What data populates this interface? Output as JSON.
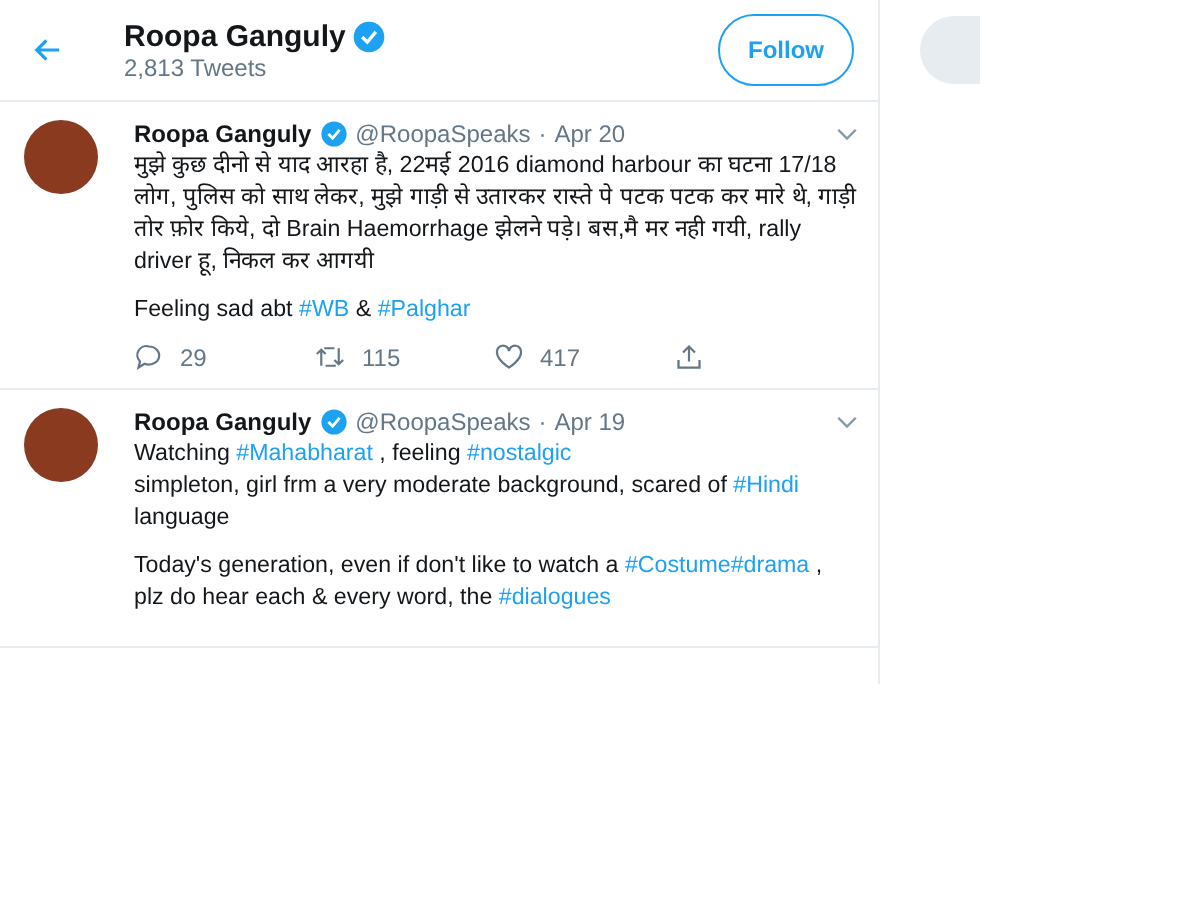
{
  "header": {
    "name": "Roopa Ganguly",
    "verified": true,
    "tweet_count": "2,813 Tweets",
    "follow_button": "Follow"
  },
  "tweets": [
    {
      "name": "Roopa Ganguly",
      "verified": true,
      "handle": "@RoopaSpeaks",
      "separator": "·",
      "date": "Apr 20",
      "paragraphs": [
        [
          {
            "kind": "text",
            "text": "मुझे कुछ दीनो से याद आरहा है, 22मई 2016 diamond harbour का घटना 17/18 लोग, पुलिस को साथ लेकर, मुझे गाड़ी से उतारकर रास्ते पे पटक पटक कर मारे थे, गाड़ी तोर फ़ोर किये, दो Brain Haemorrhage झेलने पड़े। बस,मै मर नही गयी, rally driver हू, निकल कर आगयी"
          }
        ],
        [
          {
            "kind": "text",
            "text": "Feeling sad abt "
          },
          {
            "kind": "hashtag",
            "text": "#WB"
          },
          {
            "kind": "text",
            "text": " & "
          },
          {
            "kind": "hashtag",
            "text": "#Palghar"
          }
        ]
      ],
      "actions": {
        "replies": "29",
        "retweets": "115",
        "likes": "417"
      }
    },
    {
      "name": "Roopa Ganguly",
      "verified": true,
      "handle": "@RoopaSpeaks",
      "separator": "·",
      "date": "Apr 19",
      "paragraphs": [
        [
          {
            "kind": "text",
            "text": "Watching "
          },
          {
            "kind": "hashtag",
            "text": "#Mahabharat"
          },
          {
            "kind": "text",
            "text": " , feeling "
          },
          {
            "kind": "hashtag",
            "text": "#nostalgic"
          },
          {
            "kind": "break"
          },
          {
            "kind": "text",
            "text": "simpleton, girl frm a very moderate background, scared of "
          },
          {
            "kind": "hashtag",
            "text": "#Hindi"
          },
          {
            "kind": "text",
            "text": " language"
          }
        ],
        [
          {
            "kind": "text",
            "text": "Today's generation, even if don't like to watch a "
          },
          {
            "kind": "hashtag",
            "text": "#Costume"
          },
          {
            "kind": "space"
          },
          {
            "kind": "hashtag",
            "text": "#drama"
          },
          {
            "kind": "text",
            "text": " , plz do hear each & every word, the "
          },
          {
            "kind": "hashtag",
            "text": "#dialogues"
          }
        ]
      ]
    }
  ]
}
